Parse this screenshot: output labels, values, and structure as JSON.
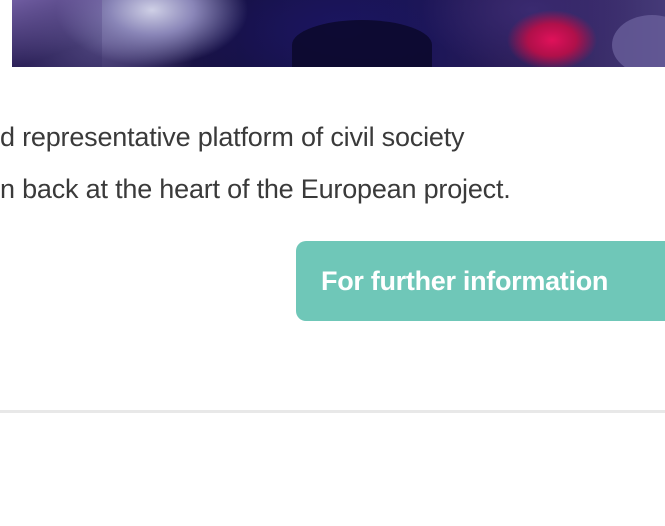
{
  "hero": {
    "alt": "Audience in a conference hall"
  },
  "intro": {
    "line1": "d representative platform of civil society",
    "line2": "n back at the heart of the European project."
  },
  "cta": {
    "label": "For further information"
  }
}
